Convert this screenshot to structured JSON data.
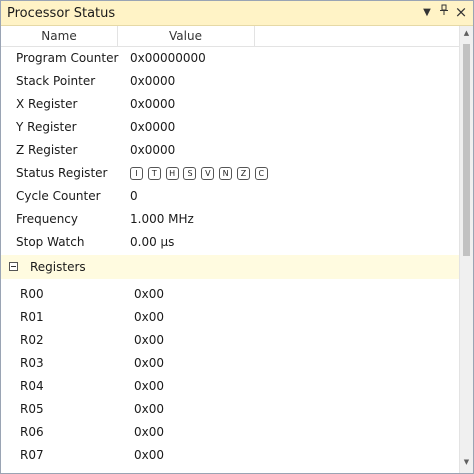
{
  "window": {
    "title": "Processor Status",
    "dropdown_icon": "▼",
    "pin_icon": "pin-icon",
    "close_icon": "×"
  },
  "columns": {
    "name": "Name",
    "value": "Value"
  },
  "rows": [
    {
      "name": "Program Counter",
      "value": "0x00000000"
    },
    {
      "name": "Stack Pointer",
      "value": "0x0000"
    },
    {
      "name": "X Register",
      "value": "0x0000"
    },
    {
      "name": "Y Register",
      "value": "0x0000"
    },
    {
      "name": "Z Register",
      "value": "0x0000"
    },
    {
      "name": "Status Register",
      "flags": [
        "I",
        "T",
        "H",
        "S",
        "V",
        "N",
        "Z",
        "C"
      ]
    },
    {
      "name": "Cycle Counter",
      "value": "0"
    },
    {
      "name": "Frequency",
      "value": "1.000 MHz"
    },
    {
      "name": "Stop Watch",
      "value": "0.00 µs"
    }
  ],
  "registers": {
    "label": "Registers",
    "expanded": true,
    "items": [
      {
        "name": "R00",
        "value": "0x00"
      },
      {
        "name": "R01",
        "value": "0x00"
      },
      {
        "name": "R02",
        "value": "0x00"
      },
      {
        "name": "R03",
        "value": "0x00"
      },
      {
        "name": "R04",
        "value": "0x00"
      },
      {
        "name": "R05",
        "value": "0x00"
      },
      {
        "name": "R06",
        "value": "0x00"
      },
      {
        "name": "R07",
        "value": "0x00"
      }
    ]
  },
  "colors": {
    "titlebar_bg": "#fff3c6",
    "section_bg": "#fffbe0",
    "border": "#9aa4b4"
  }
}
